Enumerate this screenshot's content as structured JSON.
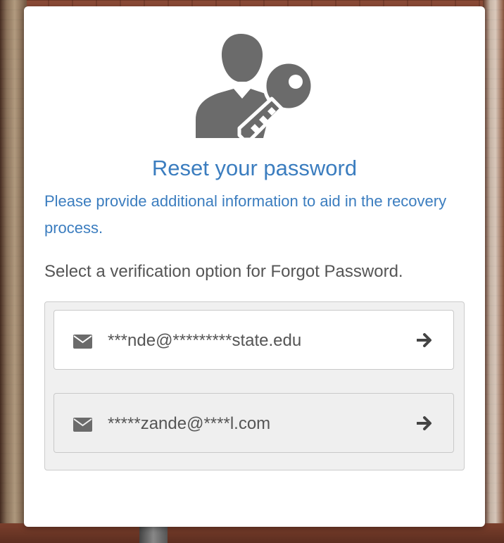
{
  "dialog": {
    "title": "Reset your password",
    "subtitle": "Please provide additional information to aid in the recovery process.",
    "instruction": "Select a verification option for Forgot Password."
  },
  "options": [
    {
      "icon": "envelope-icon",
      "label": "***nde@*********state.edu",
      "action_icon": "arrow-right-icon"
    },
    {
      "icon": "envelope-icon",
      "label": "*****zande@****l.com",
      "action_icon": "arrow-right-icon"
    }
  ],
  "colors": {
    "accent": "#3b7dbf",
    "text": "#555555",
    "icon": "#6b6b6b",
    "panel_bg": "#f0f0f0"
  },
  "hero_icon": "user-key-icon"
}
